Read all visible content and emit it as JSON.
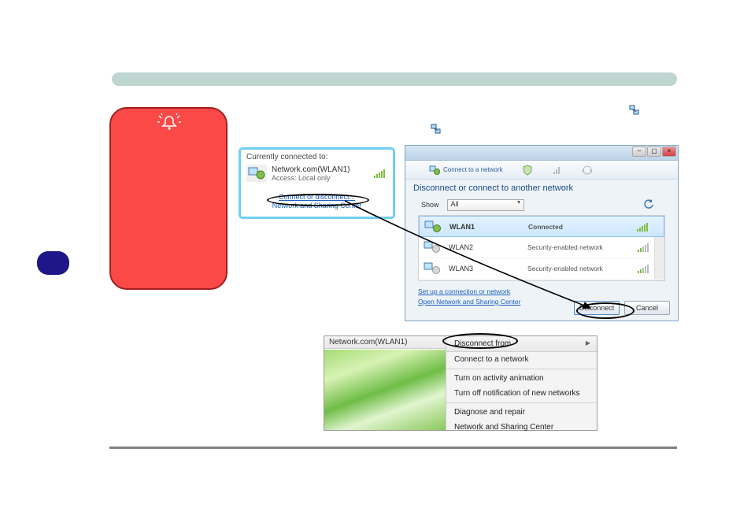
{
  "popup1": {
    "title": "Currently connected to:",
    "network_name": "Network.com(WLAN1)",
    "access_line": "Access:  Local only",
    "link_connect_disconnect": "Connect or disconnect...",
    "link_sharing_center": "Network and Sharing Center"
  },
  "popup2": {
    "toolbar_connect": "Connect to a network",
    "heading": "Disconnect or connect to another network",
    "show_label": "Show",
    "show_value": "All",
    "items": [
      {
        "name": "WLAN1",
        "status": "Connected"
      },
      {
        "name": "WLAN2",
        "status": "Security-enabled network"
      },
      {
        "name": "WLAN3",
        "status": "Security-enabled network"
      }
    ],
    "link_setup": "Set up a connection or network",
    "link_open_center": "Open Network and Sharing Center",
    "btn_disconnect": "Disconnect",
    "btn_cancel": "Cancel"
  },
  "popup3": {
    "left_label": "Network.com(WLAN1)",
    "menu": {
      "disconnect_from": "Disconnect from",
      "connect_network": "Connect to a network",
      "activity_anim": "Turn on activity animation",
      "turn_off_notif": "Turn off notification of new networks",
      "diagnose": "Diagnose and repair",
      "sharing_center": "Network and Sharing Center"
    }
  }
}
